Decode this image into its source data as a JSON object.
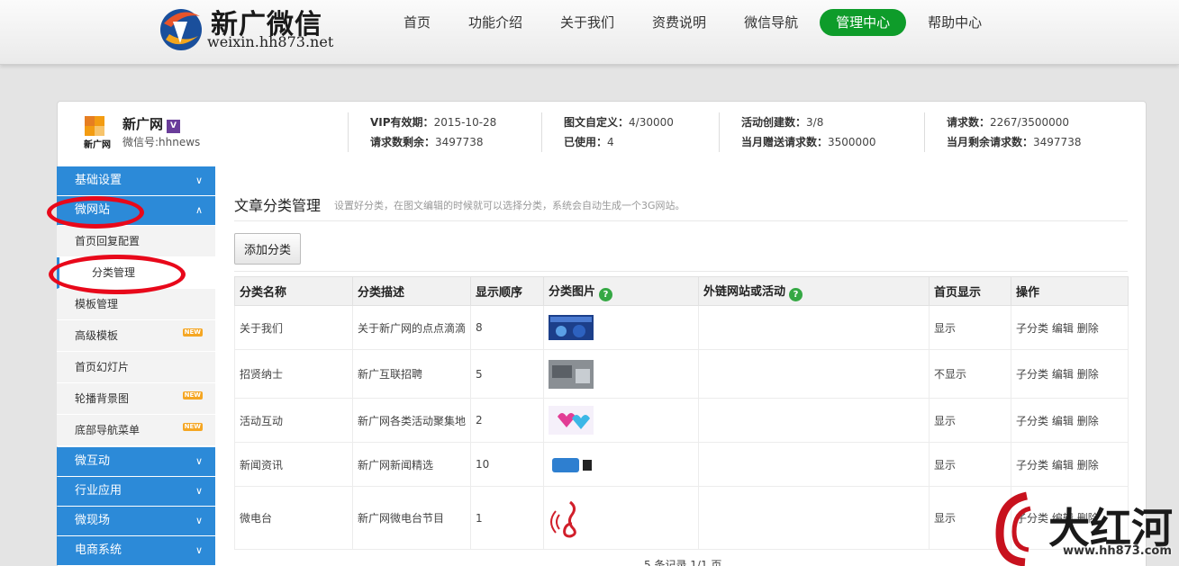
{
  "header": {
    "logo_name": "新广微信",
    "logo_url": "weixin.hh873.net",
    "nav": [
      {
        "label": "首页",
        "active": false
      },
      {
        "label": "功能介绍",
        "active": false
      },
      {
        "label": "关于我们",
        "active": false
      },
      {
        "label": "资费说明",
        "active": false
      },
      {
        "label": "微信导航",
        "active": false
      },
      {
        "label": "管理中心",
        "active": true
      },
      {
        "label": "帮助中心",
        "active": false
      }
    ]
  },
  "account": {
    "logo_text": "新广网",
    "name": "新广网",
    "vip_badge": "V",
    "wechat_id": "微信号:hhnews"
  },
  "stats": {
    "vip_label": "VIP有效期：",
    "vip_value": "2015-10-28",
    "remaining_label": "请求数剩余：",
    "remaining_value": "3497738",
    "custom_label": "图文自定义：",
    "custom_value": "4/30000",
    "used_label": "已使用：",
    "used_value": "4",
    "activity_label": "活动创建数：",
    "activity_value": "3/8",
    "gift_label": "当月赠送请求数：",
    "gift_value": "3500000",
    "requests_label": "请求数：",
    "requests_value": "2267/3500000",
    "month_left_label": "当月剩余请求数：",
    "month_left_value": "3497738"
  },
  "sidebar": {
    "basic": "基础设置",
    "microsite": "微网站",
    "items": [
      "首页回复配置",
      "分类管理",
      "模板管理",
      "高级模板",
      "首页幻灯片",
      "轮播背景图",
      "底部导航菜单"
    ],
    "new_badge": "NEW",
    "interaction": "微互动",
    "industry": "行业应用",
    "scene": "微现场",
    "ecommerce": "电商系统"
  },
  "main": {
    "title": "文章分类管理",
    "hint": "设置好分类，在图文编辑的时候就可以选择分类，系统会自动生成一个3G网站。",
    "add_button": "添加分类",
    "columns": {
      "name": "分类名称",
      "desc": "分类描述",
      "order": "显示顺序",
      "image": "分类图片",
      "link": "外链网站或活动",
      "show": "首页显示",
      "ops": "操作"
    },
    "help_glyph": "?",
    "rows": [
      {
        "name": "关于我们",
        "desc": "关于新广网的点点滴滴",
        "order": "8",
        "show": "显示",
        "sub": "子分类",
        "edit": "编辑",
        "del": "删除"
      },
      {
        "name": "招贤纳士",
        "desc": "新广互联招聘",
        "order": "5",
        "show": "不显示",
        "sub": "子分类",
        "edit": "编辑",
        "del": "删除"
      },
      {
        "name": "活动互动",
        "desc": "新广网各类活动聚集地",
        "order": "2",
        "show": "显示",
        "sub": "子分类",
        "edit": "编辑",
        "del": "删除"
      },
      {
        "name": "新闻资讯",
        "desc": "新广网新闻精选",
        "order": "10",
        "show": "显示",
        "sub": "子分类",
        "edit": "编辑",
        "del": "删除"
      },
      {
        "name": "微电台",
        "desc": "新广网微电台节目",
        "order": "1",
        "show": "显示",
        "sub": "子分类",
        "edit": "编辑",
        "del": "删除"
      }
    ],
    "pager": "5 条记录 1/1 页"
  },
  "watermark": {
    "text": "大红河",
    "url": "www.hh873.com"
  },
  "colors": {
    "nav_active": "#0e9c2a",
    "sidebar_head": "#2c8ad8",
    "highlight_ring": "#e8081a",
    "help_icon": "#35a844"
  }
}
